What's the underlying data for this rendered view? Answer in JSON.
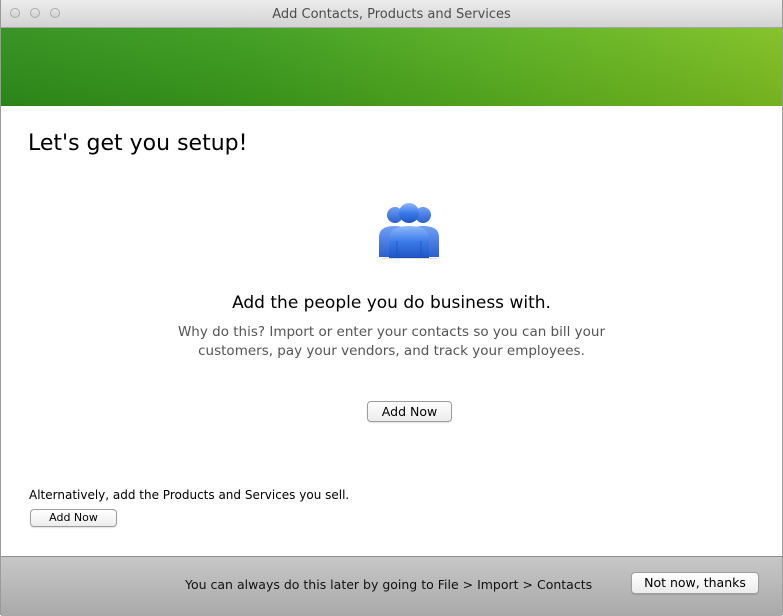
{
  "window": {
    "title": "Add Contacts, Products and Services"
  },
  "main": {
    "heading": "Let's get you setup!",
    "icon": "people-group-icon",
    "title": "Add the people you do business with.",
    "description_line1": "Why do this? Import or enter your contacts so you can bill your",
    "description_line2": "customers, pay your vendors, and track your employees.",
    "add_button_label": "Add Now"
  },
  "alternative": {
    "text": "Alternatively, add the Products and Services you sell.",
    "add_button_label": "Add Now"
  },
  "footer": {
    "text": "You can always do this later by going to File > Import > Contacts",
    "dismiss_button_label": "Not now, thanks"
  },
  "colors": {
    "banner_start": "#2f8f1a",
    "banner_end": "#7ec021",
    "icon_blue": "#2e6fe0"
  }
}
